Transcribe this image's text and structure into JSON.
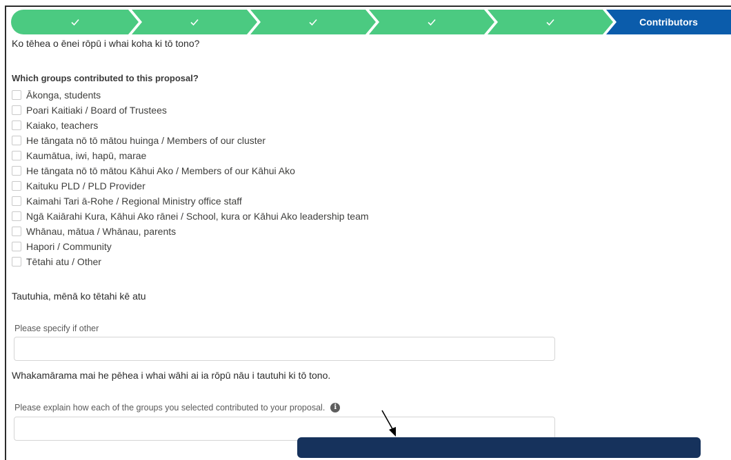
{
  "path": {
    "steps": [
      {
        "icon": "check-icon",
        "complete": true
      },
      {
        "icon": "check-icon",
        "complete": true
      },
      {
        "icon": "check-icon",
        "complete": true
      },
      {
        "icon": "check-icon",
        "complete": true
      },
      {
        "icon": "check-icon",
        "complete": true
      },
      {
        "label": "Contributors",
        "current": true
      }
    ],
    "colors": {
      "complete": "#4bca81",
      "current": "#0b5cab"
    }
  },
  "form": {
    "question_maori": "Ko tēhea o ēnei rōpū i whai koha ki tō tono?",
    "question_english": "Which groups contributed to this proposal?",
    "options": [
      "Ākonga, students",
      "Poari Kaitiaki / Board of Trustees",
      "Kaiako, teachers",
      "He tāngata nō tō mātou huinga / Members of our cluster",
      "Kaumātua, iwi, hapū, marae",
      "He tāngata nō tō mātou Kāhui Ako / Members of our Kāhui Ako",
      "Kaituku PLD / PLD Provider",
      "Kaimahi Tari ā-Rohe / Regional Ministry office staff",
      "Ngā Kaiārahi Kura, Kāhui Ako rānei / School, kura or Kāhui Ako leadership team",
      "Whānau, mātua / Whānau, parents",
      "Hapori / Community",
      "Tētahi atu / Other"
    ],
    "other_heading": "Tautuhia, mēnā ko tētahi kē atu",
    "other_label": "Please specify if other",
    "other_value": "",
    "explain_heading": "Whakamārama mai he pēhea i whai wāhi ai ia rōpū nāu i tautuhi ki tō tono.",
    "explain_label": "Please explain how each of the groups you selected contributed to your proposal.",
    "explain_value": "",
    "info_icon": "info-icon"
  },
  "tooltip": {
    "color": "#16325c"
  }
}
